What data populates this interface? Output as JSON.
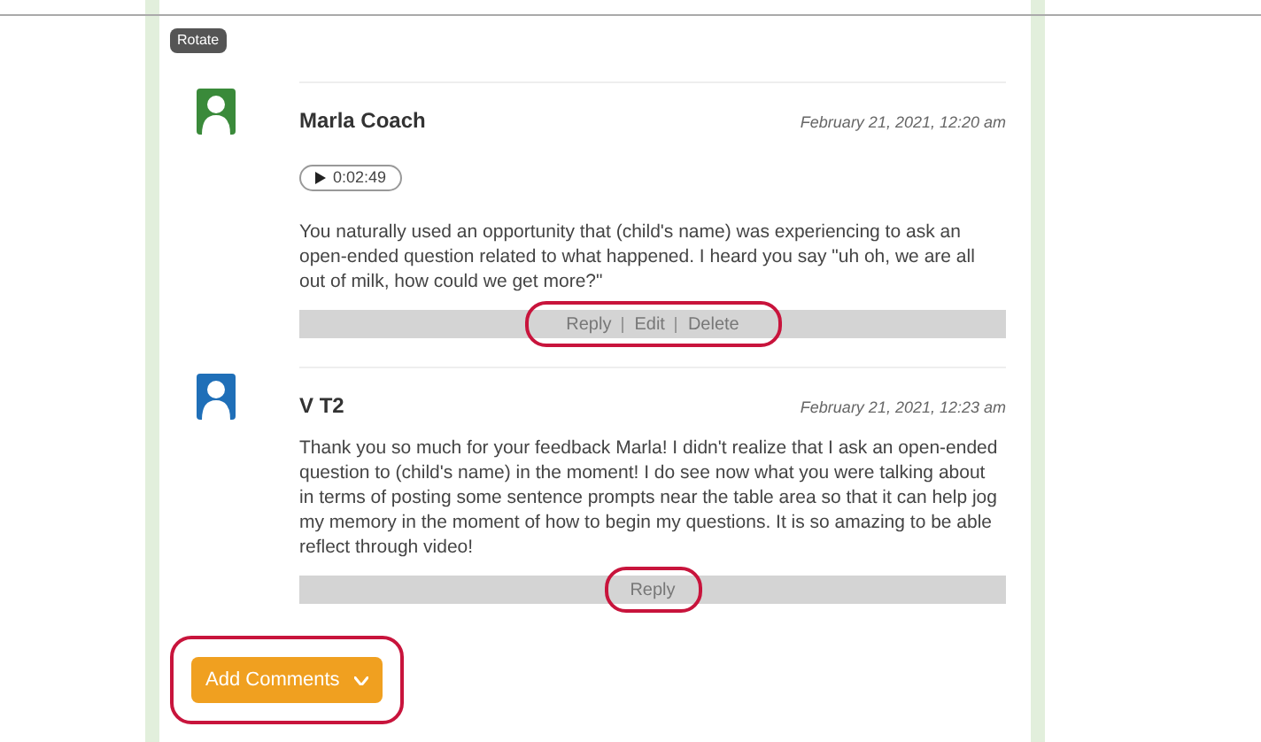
{
  "rotate_label": "Rotate",
  "comments": [
    {
      "author": "Marla Coach",
      "date": "February 21, 2021, 12:20 am",
      "color": "#3a8a3a",
      "audio": "0:02:49",
      "text": "You naturally used an opportunity that (child's name) was experiencing to ask an open-ended question related to what happened. I heard you say \"uh oh, we are all out of milk, how could we get more?\"",
      "actions": [
        "Reply",
        "Edit",
        "Delete"
      ],
      "highlighted": true
    },
    {
      "author": "V T2",
      "date": "February 21, 2021, 12:23 am",
      "color": "#1f6fb8",
      "text": "Thank you so much for your feedback Marla! I didn't realize that I ask an open-ended question to (child's name) in the moment! I do see now what you were talking about in terms of posting some sentence prompts near the table area so that it can help jog my memory in the moment of how to begin my questions. It is so amazing to be able reflect through video!",
      "actions": [
        "Reply"
      ],
      "highlighted": true
    }
  ],
  "add_button": {
    "label": "Add Comments",
    "highlighted": true
  }
}
